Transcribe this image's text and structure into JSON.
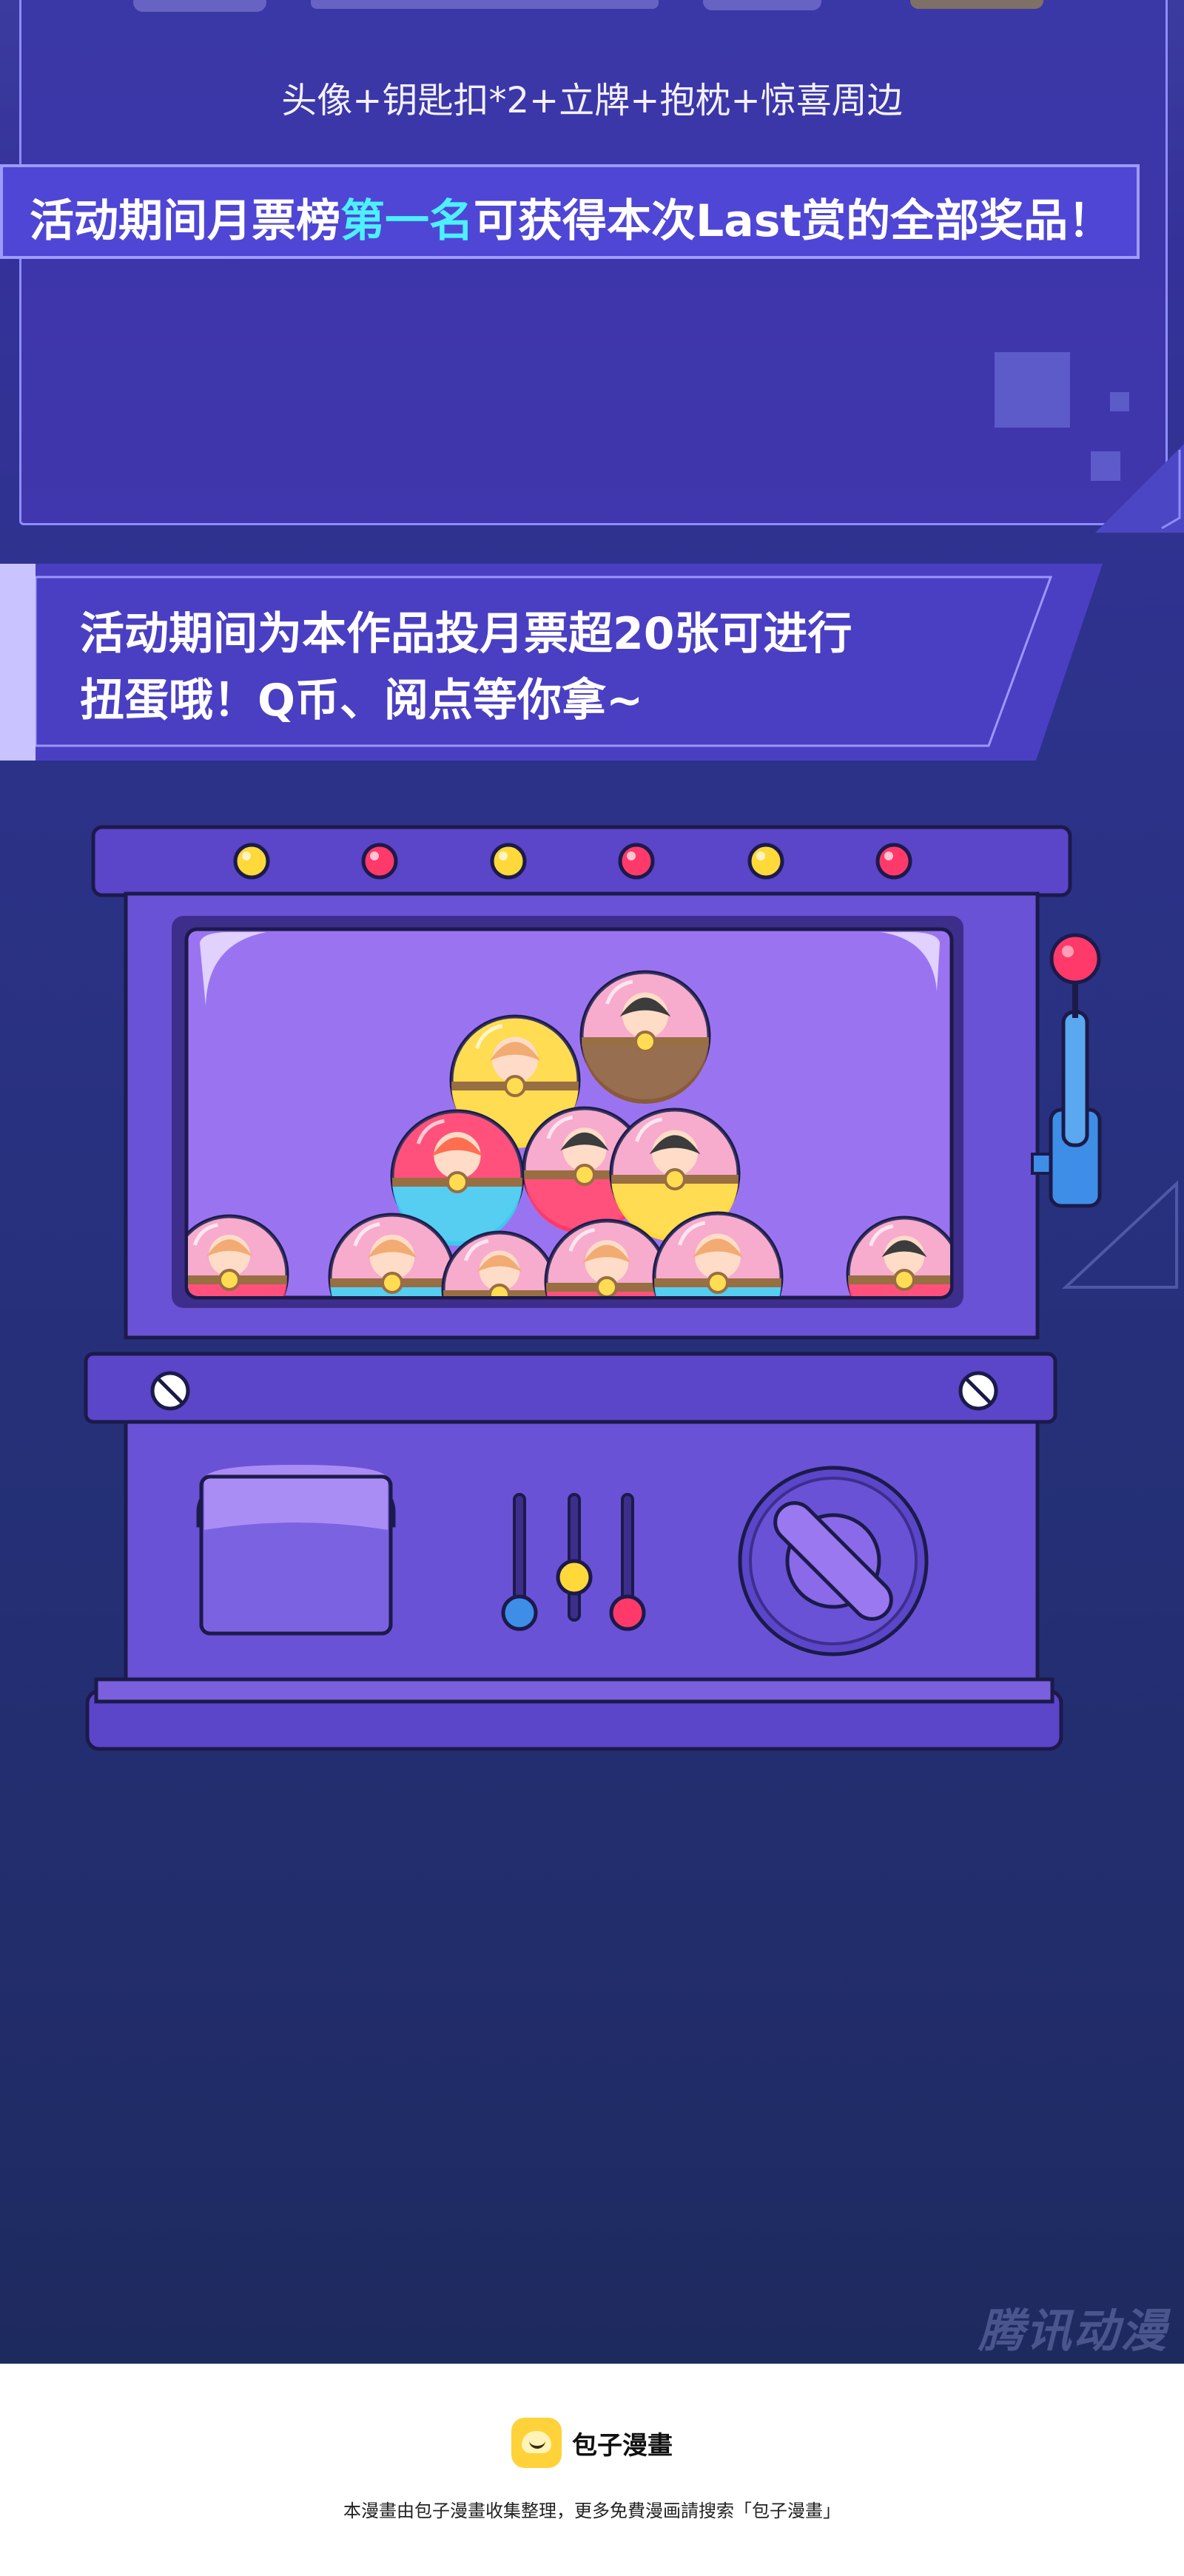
{
  "prize_panel": {
    "items_text": "头像+钥匙扣*2+立牌+抱枕+惊喜周边"
  },
  "rule_banner": {
    "text_before": "活动期间月票榜",
    "text_highlight": "第一名",
    "text_after": "可获得本次Last赏的全部奖品！",
    "highlight_color": "#4df0ff",
    "banner_color": "#4f46d6"
  },
  "notice": {
    "line1": "活动期间为本作品投月票超20张可进行",
    "line2": "扭蛋哦！Q币、阅点等你拿~"
  },
  "gacha_machine": {
    "body_color": "#5b45c9",
    "window_color": "#9a74f0",
    "top_lights": [
      "yellow-light",
      "red-light",
      "yellow-light",
      "red-light",
      "yellow-light",
      "red-light"
    ],
    "capsules": [
      {
        "top": "yellow",
        "bottom": "yellow",
        "figure": "orange-hair-chibi"
      },
      {
        "top": "pink",
        "bottom": "brown",
        "figure": "ghost-chibi"
      },
      {
        "top": "red",
        "bottom": "cyan",
        "figure": "red-hat-chibi"
      },
      {
        "top": "pink",
        "bottom": "red",
        "figure": "black-hair-chibi"
      },
      {
        "top": "pink",
        "bottom": "yellow",
        "figure": "black-hair-chibi"
      },
      {
        "top": "pink",
        "bottom": "red",
        "figure": "orange-hair-chibi"
      },
      {
        "top": "pink",
        "bottom": "cyan",
        "figure": "orange-hair-chibi"
      },
      {
        "top": "pink",
        "bottom": "yellow",
        "figure": "orange-hair-chibi"
      },
      {
        "top": "pink",
        "bottom": "red",
        "figure": "orange-hair-chibi"
      },
      {
        "top": "pink",
        "bottom": "cyan",
        "figure": "orange-hair-chibi"
      },
      {
        "top": "pink",
        "bottom": "red",
        "figure": "black-hair-chibi"
      }
    ],
    "slider_knobs": [
      "blue-knob",
      "yellow-knob",
      "red-knob"
    ]
  },
  "watermark": {
    "text": "腾讯动漫"
  },
  "footer": {
    "brand": "包子漫畫",
    "note": "本漫畫由包子漫畫收集整理，更多免費漫画請搜索「包子漫畫」"
  }
}
